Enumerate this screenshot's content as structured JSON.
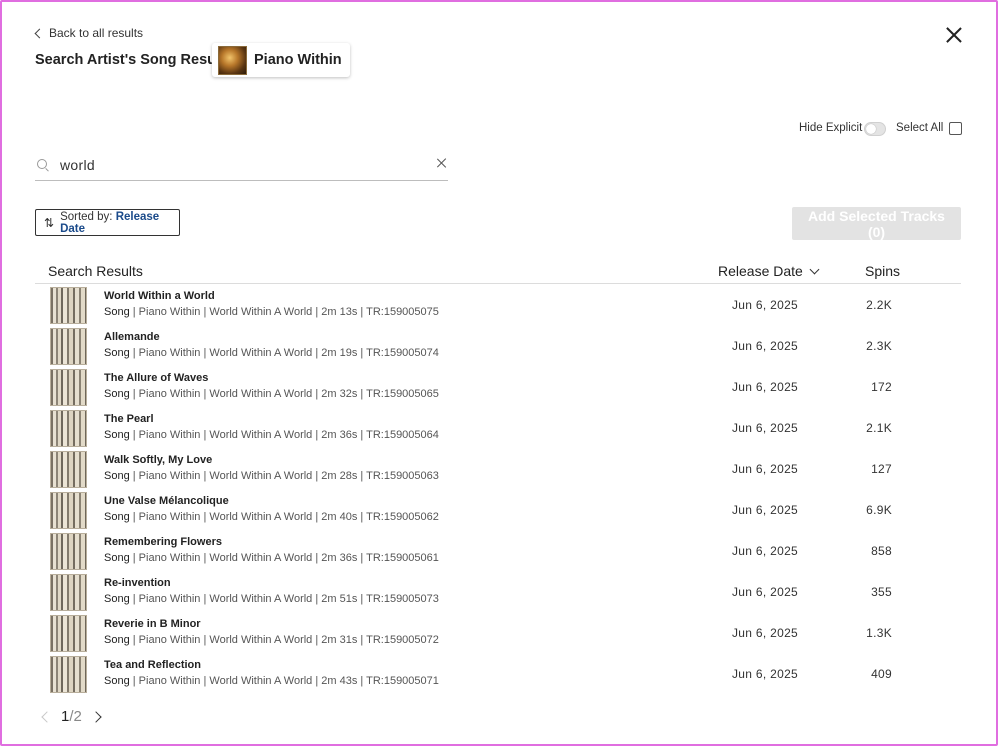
{
  "nav": {
    "back_label": "Back to all results"
  },
  "header": {
    "title": "Search Artist's Song Results",
    "artist_name": "Piano Within"
  },
  "filters": {
    "hide_explicit_label": "Hide Explicit",
    "hide_explicit_on": false,
    "select_all_label": "Select All",
    "select_all_checked": false
  },
  "search": {
    "value": "world",
    "placeholder": ""
  },
  "sort": {
    "label": "Sorted by:",
    "value": "Release Date"
  },
  "add_button_label": "Add Selected Tracks (0)",
  "table": {
    "results_header": "Search Results",
    "date_header": "Release Date",
    "spins_header": "Spins"
  },
  "tracks": [
    {
      "name": "World Within a World",
      "type": "Song",
      "meta": " | Piano Within | World Within A World | 2m 13s | TR:159005075",
      "date": "Jun 6, 2025",
      "spins": "2.2K"
    },
    {
      "name": "Allemande",
      "type": "Song",
      "meta": " | Piano Within | World Within A World | 2m 19s | TR:159005074",
      "date": "Jun 6, 2025",
      "spins": "2.3K"
    },
    {
      "name": "The Allure of Waves",
      "type": "Song",
      "meta": " | Piano Within | World Within A World | 2m 32s | TR:159005065",
      "date": "Jun 6, 2025",
      "spins": "172"
    },
    {
      "name": "The Pearl",
      "type": "Song",
      "meta": " | Piano Within | World Within A World | 2m 36s | TR:159005064",
      "date": "Jun 6, 2025",
      "spins": "2.1K"
    },
    {
      "name": "Walk Softly, My Love",
      "type": "Song",
      "meta": " | Piano Within | World Within A World | 2m 28s | TR:159005063",
      "date": "Jun 6, 2025",
      "spins": "127"
    },
    {
      "name": "Une Valse Mélancolique",
      "type": "Song",
      "meta": " | Piano Within | World Within A World | 2m 40s | TR:159005062",
      "date": "Jun 6, 2025",
      "spins": "6.9K"
    },
    {
      "name": "Remembering Flowers",
      "type": "Song",
      "meta": " | Piano Within | World Within A World | 2m 36s | TR:159005061",
      "date": "Jun 6, 2025",
      "spins": "858"
    },
    {
      "name": "Re-invention",
      "type": "Song",
      "meta": " | Piano Within | World Within A World | 2m 51s | TR:159005073",
      "date": "Jun 6, 2025",
      "spins": "355"
    },
    {
      "name": "Reverie in B Minor",
      "type": "Song",
      "meta": " | Piano Within | World Within A World | 2m 31s | TR:159005072",
      "date": "Jun 6, 2025",
      "spins": "1.3K"
    },
    {
      "name": "Tea and Reflection",
      "type": "Song",
      "meta": " | Piano Within | World Within A World | 2m 43s | TR:159005071",
      "date": "Jun 6, 2025",
      "spins": "409"
    }
  ],
  "pagination": {
    "current": "1",
    "separator": "/",
    "total": "2"
  },
  "icons": {
    "back": "chevron-left-icon",
    "close": "close-icon",
    "search": "search-icon",
    "clear": "clear-icon",
    "sort": "sort-arrows-icon",
    "date_sort": "chevron-down-icon",
    "prev": "chevron-left-icon",
    "next": "chevron-right-icon"
  },
  "colors": {
    "border_accent": "#e06ee0",
    "sort_value": "#1a4a8a",
    "disabled_button": "#e3e3e3"
  }
}
